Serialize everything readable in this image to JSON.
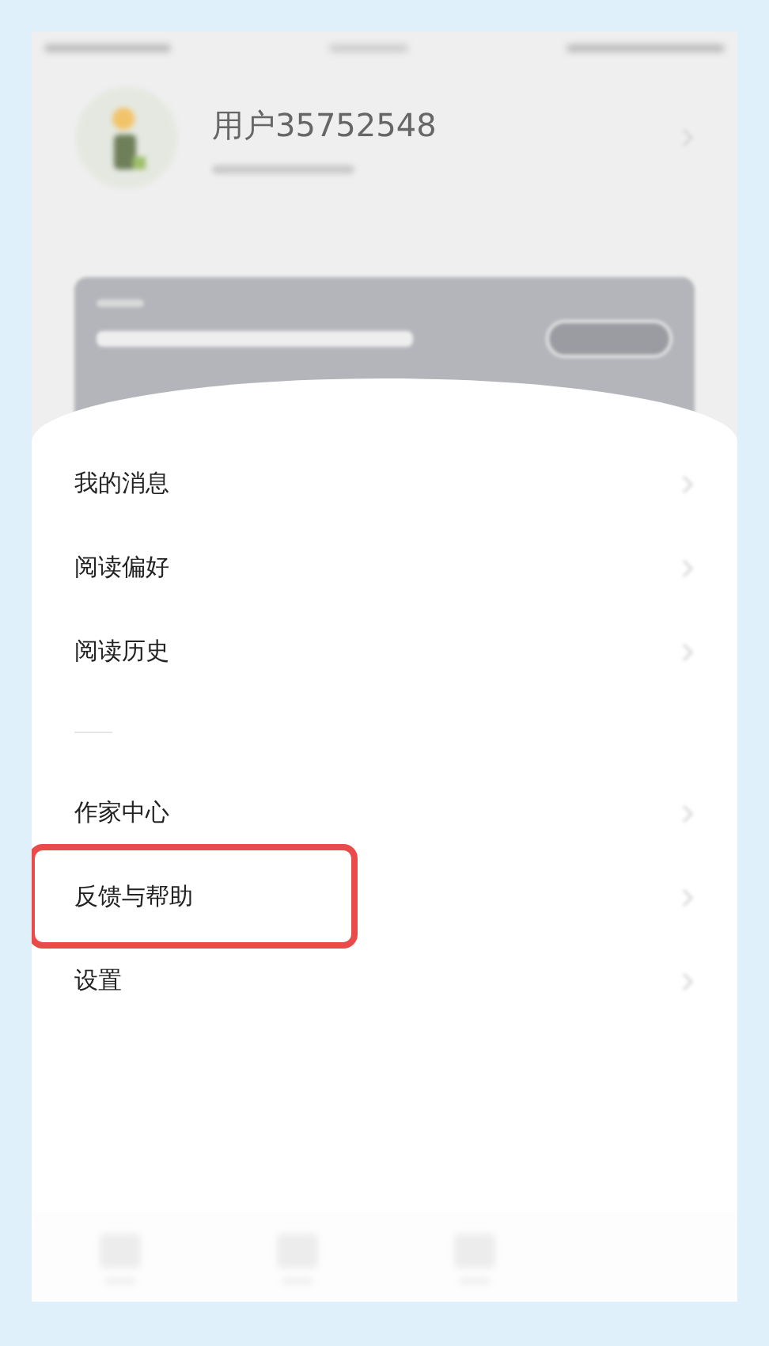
{
  "profile": {
    "username": "用户35752548"
  },
  "menu_groups": [
    {
      "items": [
        {
          "label": "我的消息",
          "highlighted": false
        },
        {
          "label": "阅读偏好",
          "highlighted": false
        },
        {
          "label": "阅读历史",
          "highlighted": false
        }
      ]
    },
    {
      "items": [
        {
          "label": "作家中心",
          "highlighted": false
        },
        {
          "label": "反馈与帮助",
          "highlighted": true
        },
        {
          "label": "设置",
          "highlighted": false
        }
      ]
    }
  ]
}
